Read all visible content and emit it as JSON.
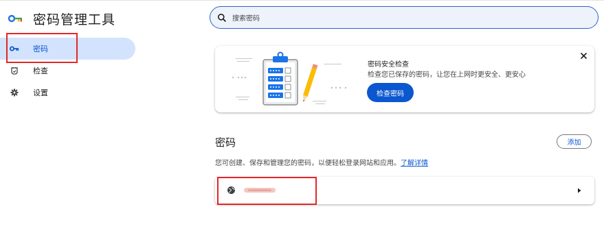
{
  "app": {
    "title": "密码管理工具"
  },
  "sidebar": {
    "items": [
      {
        "label": "密码",
        "icon": "key-icon",
        "active": true
      },
      {
        "label": "检查",
        "icon": "shield-check-icon",
        "active": false
      },
      {
        "label": "设置",
        "icon": "gear-icon",
        "active": false
      }
    ]
  },
  "search": {
    "placeholder": "搜索密码",
    "value": ""
  },
  "checkup_card": {
    "title": "密码安全检查",
    "description": "检查您已保存的密码，让您在上网时更安全、更安心",
    "button_label": "检查密码",
    "close_icon": "close-icon"
  },
  "passwords_section": {
    "title": "密码",
    "add_label": "添加",
    "description": "您可创建、保存和管理您的密码，以便轻松登录网站和应用。",
    "learn_more": "了解详情",
    "rows": [
      {
        "icon": "globe-icon",
        "site": ""
      }
    ]
  },
  "colors": {
    "accent": "#0b57d0",
    "active_bg": "#d3e3fd",
    "highlight": "#e32626",
    "search_bg": "#eef3fb"
  }
}
